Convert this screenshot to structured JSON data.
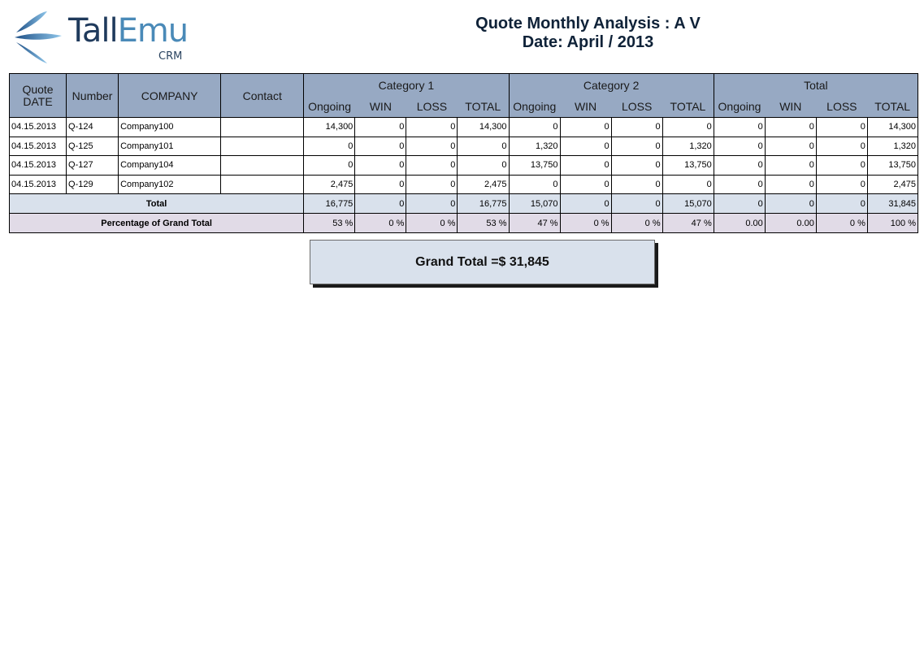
{
  "logo": {
    "brand_part1": "Tall",
    "brand_part2": "Emu",
    "product": "CRM"
  },
  "report": {
    "title": "Quote Monthly Analysis : A V",
    "date_line": "Date: April / 2013"
  },
  "table": {
    "headers": {
      "quote_date": "Quote DATE",
      "number": "Number",
      "company": "COMPANY",
      "contact": "Contact",
      "groups": [
        "Category 1",
        "Category 2",
        "Total"
      ],
      "sub": [
        "Ongoing",
        "WIN",
        "LOSS",
        "TOTAL"
      ]
    },
    "rows": [
      {
        "date": "04.15.2013",
        "number": "Q-124",
        "company": "Company100",
        "contact": "",
        "values": [
          "14,300",
          "0",
          "0",
          "14,300",
          "0",
          "0",
          "0",
          "0",
          "0",
          "0",
          "0",
          "14,300"
        ]
      },
      {
        "date": "04.15.2013",
        "number": "Q-125",
        "company": "Company101",
        "contact": "",
        "values": [
          "0",
          "0",
          "0",
          "0",
          "1,320",
          "0",
          "0",
          "1,320",
          "0",
          "0",
          "0",
          "1,320"
        ]
      },
      {
        "date": "04.15.2013",
        "number": "Q-127",
        "company": "Company104",
        "contact": "",
        "values": [
          "0",
          "0",
          "0",
          "0",
          "13,750",
          "0",
          "0",
          "13,750",
          "0",
          "0",
          "0",
          "13,750"
        ]
      },
      {
        "date": "04.15.2013",
        "number": "Q-129",
        "company": "Company102",
        "contact": "",
        "values": [
          "2,475",
          "0",
          "0",
          "2,475",
          "0",
          "0",
          "0",
          "0",
          "0",
          "0",
          "0",
          "2,475"
        ]
      }
    ],
    "total_row": {
      "label": "Total",
      "values": [
        "16,775",
        "0",
        "0",
        "16,775",
        "15,070",
        "0",
        "0",
        "15,070",
        "0",
        "0",
        "0",
        "31,845"
      ]
    },
    "percent_row": {
      "label": "Percentage of Grand Total",
      "values": [
        "53 %",
        "0 %",
        "0 %",
        "53 %",
        "47 %",
        "0 %",
        "0 %",
        "47 %",
        "0.00",
        "0.00",
        "0 %",
        "100 %"
      ]
    }
  },
  "grand_total": "Grand Total =$ 31,845",
  "colors": {
    "header_bg": "#97a9c3",
    "total_row_bg": "#d9e1ec",
    "percent_row_bg": "#e1dbe7",
    "grand_box_bg": "#d9e1ec",
    "brand_dark": "#1f3a5c",
    "brand_light": "#4a8ab8"
  }
}
